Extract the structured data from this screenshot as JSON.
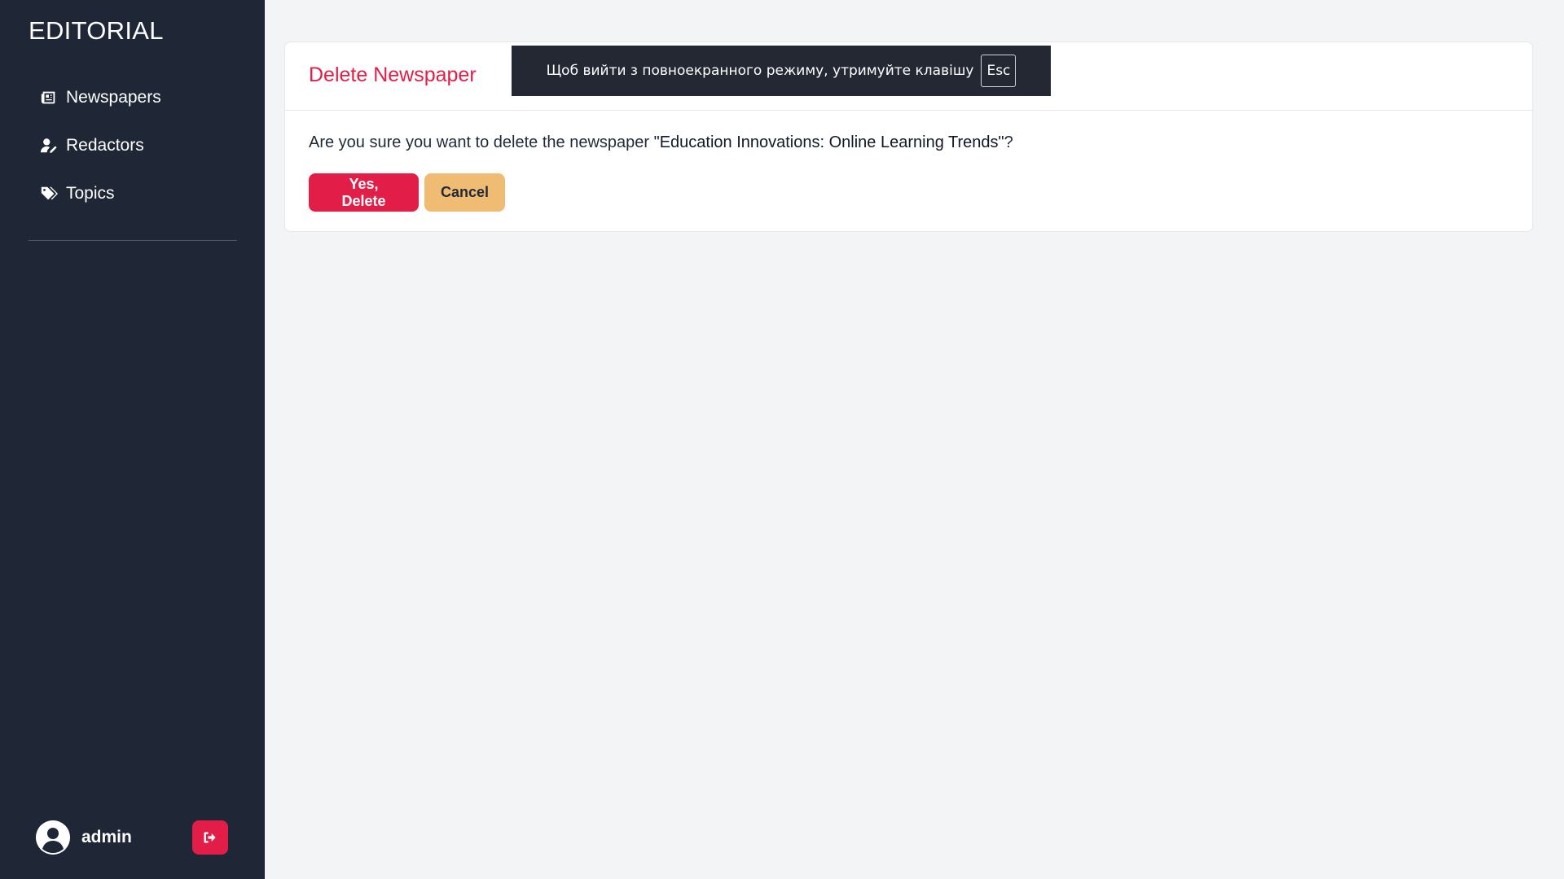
{
  "sidebar": {
    "brand": "EDITORIAL",
    "items": [
      {
        "label": "Newspapers",
        "icon": "newspaper-icon"
      },
      {
        "label": "Redactors",
        "icon": "user-pen-icon"
      },
      {
        "label": "Topics",
        "icon": "tags-icon"
      }
    ],
    "user": {
      "name": "admin",
      "icon": "user-circle-icon"
    },
    "logout_icon": "sign-out-icon"
  },
  "main": {
    "title": "Delete Newspaper",
    "question_prefix": "Are you sure you want to delete the newspaper ",
    "newspaper_name": "\"Education Innovations: Online Learning Trends\"",
    "question_suffix": "?",
    "delete_label": "Yes, Delete",
    "cancel_label": "Cancel"
  },
  "fullscreen_notice": {
    "text": "Щоб вийти з повноекранного режиму, утримуйте клавішу",
    "key": "Esc"
  },
  "colors": {
    "sidebar_bg": "#1f2737",
    "accent": "#e11d48",
    "cancel_bg": "#f0bc73",
    "page_bg": "#f3f4f6"
  }
}
